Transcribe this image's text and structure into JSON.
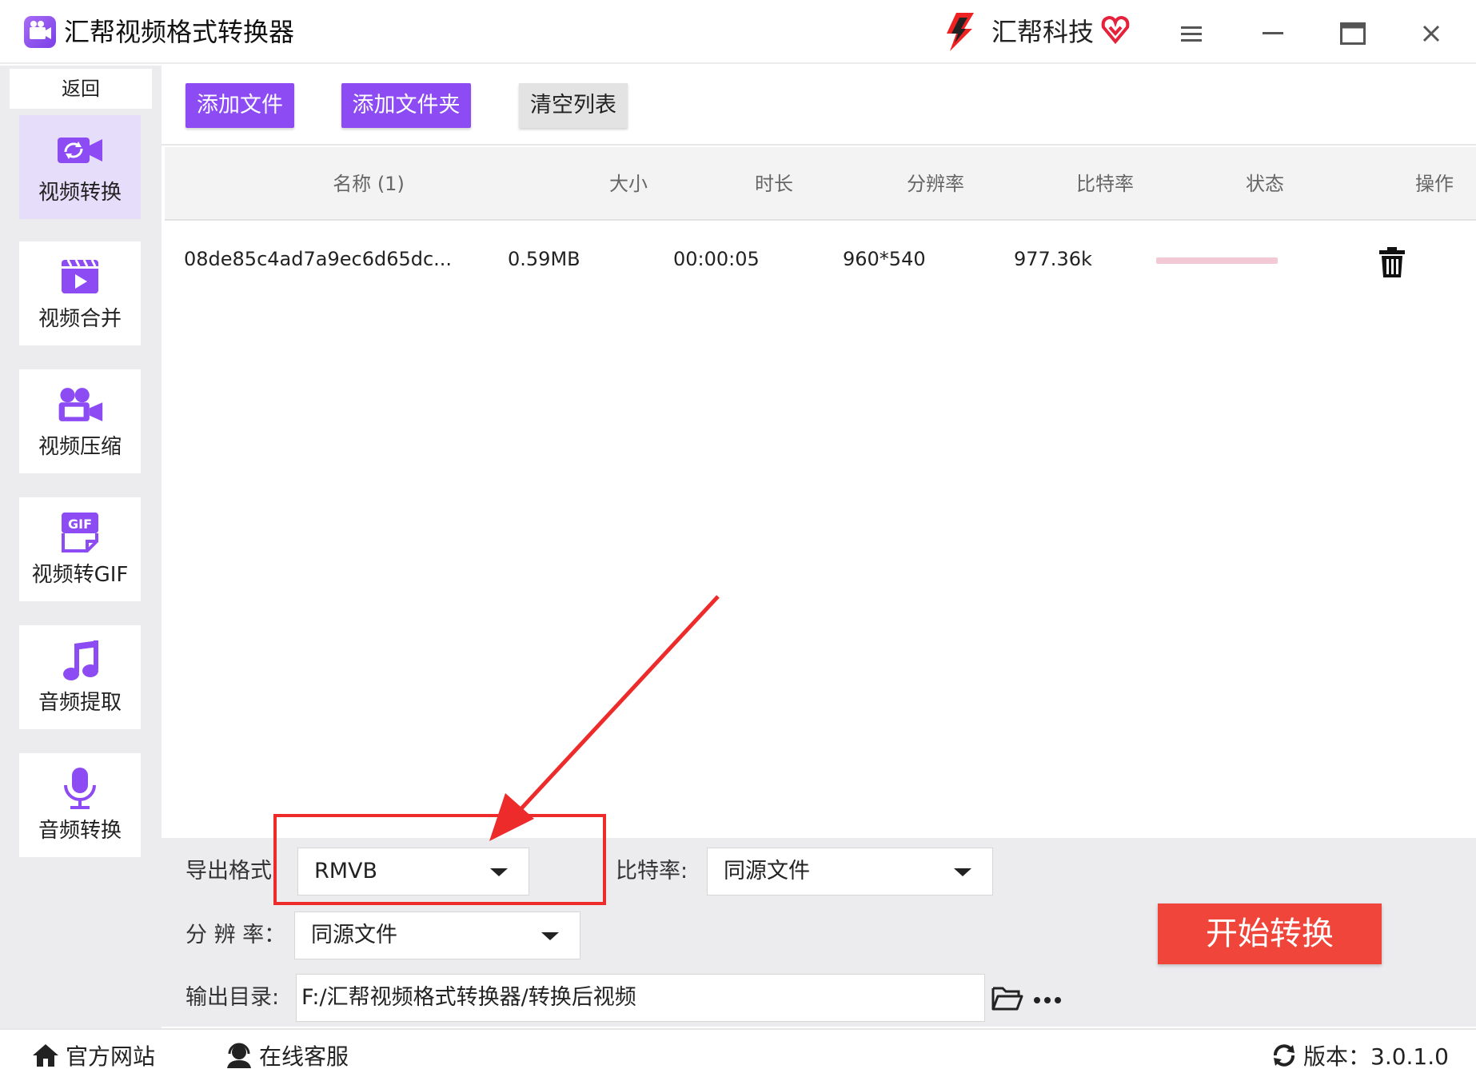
{
  "window": {
    "title": "汇帮视频格式转换器",
    "brand_name": "汇帮科技",
    "menu_icon": "hamburger-icon",
    "minimize_icon": "minimize-icon",
    "maximize_icon": "maximize-icon",
    "close_icon": "close-icon"
  },
  "sidebar": {
    "back_label": "返回",
    "items": [
      {
        "label": "视频转换",
        "icon": "video-convert-icon",
        "active": true
      },
      {
        "label": "视频合并",
        "icon": "video-merge-icon",
        "active": false
      },
      {
        "label": "视频压缩",
        "icon": "video-compress-icon",
        "active": false
      },
      {
        "label": "视频转GIF",
        "icon": "gif-icon",
        "active": false
      },
      {
        "label": "音频提取",
        "icon": "music-note-icon",
        "active": false
      },
      {
        "label": "音频转换",
        "icon": "microphone-icon",
        "active": false
      }
    ]
  },
  "toolbar": {
    "add_file": "添加文件",
    "add_folder": "添加文件夹",
    "clear_list": "清空列表"
  },
  "table": {
    "columns": [
      "名称 (1)",
      "大小",
      "时长",
      "分辨率",
      "比特率",
      "状态",
      "操作"
    ],
    "rows": [
      {
        "name": "08de85c4ad7a9ec6d65dc...",
        "size": "0.59MB",
        "duration": "00:00:05",
        "resolution": "960*540",
        "bitrate": "977.36k",
        "status_icon": "progress-bar",
        "action_icon": "trash-icon"
      }
    ]
  },
  "settings": {
    "format_label": "导出格式:",
    "format_value": "RMVB",
    "bitrate_label": "比特率:",
    "bitrate_value": "同源文件",
    "resolution_label": "分 辨 率：",
    "resolution_value": "同源文件",
    "output_label": "输出目录:",
    "output_value": "F:/汇帮视频格式转换器/转换后视频",
    "start_button": "开始转换"
  },
  "footer": {
    "website": "官方网站",
    "support": "在线客服",
    "version": "版本：3.0.1.0"
  },
  "colors": {
    "accent_purple": "#8d4cf3",
    "start_red": "#f0453a",
    "annotation_red": "#ee2b2b"
  }
}
